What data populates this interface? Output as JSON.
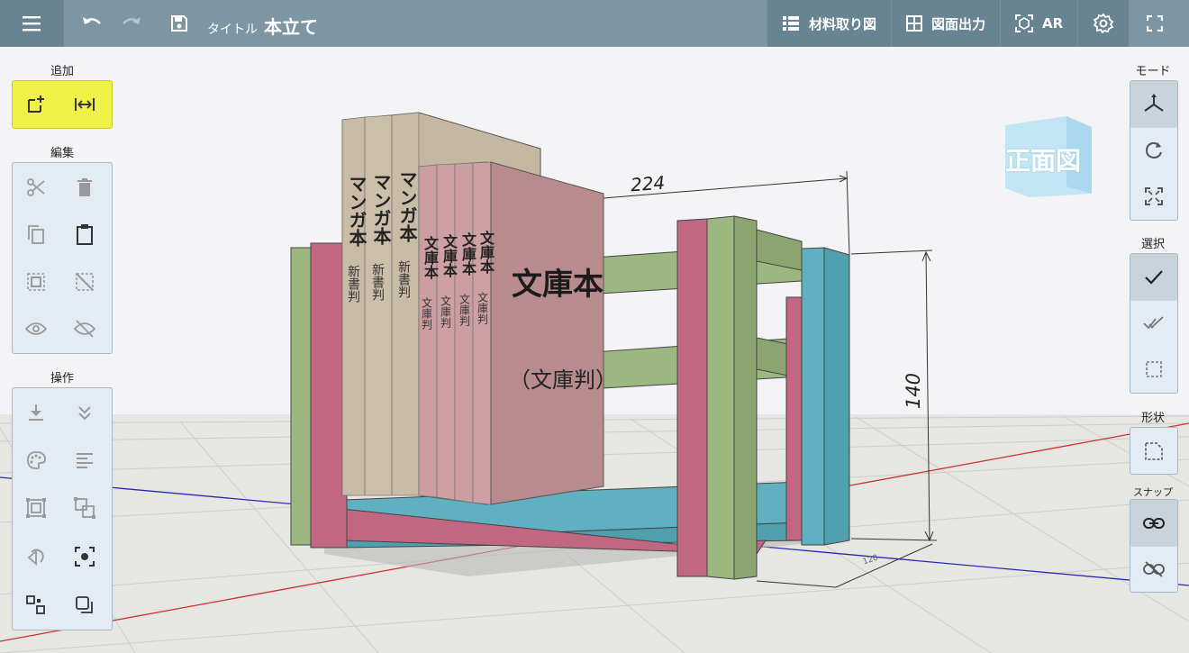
{
  "toolbar": {
    "title_label": "タイトル",
    "title": "本立て",
    "cut_list_label": "材料取り図",
    "drawing_output_label": "図面出力",
    "ar_label": "AR"
  },
  "left_panel": {
    "add_title": "追加",
    "edit_title": "編集",
    "operate_title": "操作"
  },
  "right_panel": {
    "mode_title": "モード",
    "select_title": "選択",
    "shape_title": "形状",
    "snap_title": "スナップ"
  },
  "view_cube": {
    "label": "正面図"
  },
  "scene": {
    "dim_width": "224",
    "dim_height": "140",
    "dim_depth": "120",
    "manga_spine": "マンガ本",
    "manga_sub": "新書判",
    "bunko_spine": "文庫本",
    "bunko_sub": "文庫判",
    "bunko_cover_title": "文庫本",
    "bunko_cover_sub": "（文庫判）"
  },
  "colors": {
    "topbar": "#7e96a3",
    "topbar_dark": "#688391",
    "add_highlight": "#f0f046",
    "panel_bg": "#e3ebf5",
    "board_green": "#9cb77f",
    "board_pink": "#c26782",
    "board_teal": "#5fb0c0",
    "book_tan": "#c5b8a2",
    "book_pink": "#c99a9e"
  }
}
